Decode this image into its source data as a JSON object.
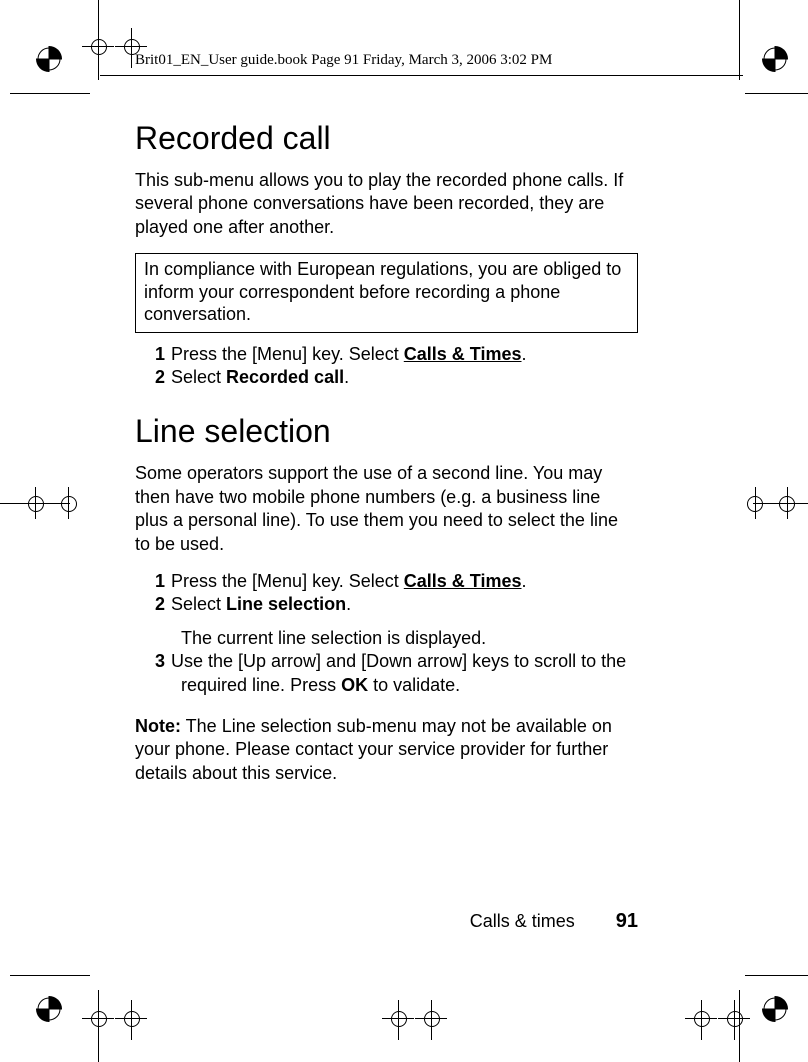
{
  "header": {
    "running_head": "Brit01_EN_User guide.book  Page 91  Friday, March 3, 2006  3:02 PM"
  },
  "section1": {
    "heading": "Recorded call",
    "intro": "This sub-menu allows you to play the recorded phone calls. If several phone conversations have been recorded, they are played one after another.",
    "notice": "In compliance with European regulations, you are obliged to inform your correspondent before recording a phone conversation.",
    "steps": {
      "s1_num": "1",
      "s1_pre": "Press the [Menu] key. Select ",
      "s1_menu": "Calls & Times",
      "s1_post": ".",
      "s2_num": "2",
      "s2_pre": "Select ",
      "s2_menu": "Recorded call",
      "s2_post": "."
    }
  },
  "section2": {
    "heading": "Line selection",
    "intro": "Some operators support the use of a second line. You may then have two mobile phone numbers (e.g. a business line plus a personal line). To use them you need to select the line to be used.",
    "steps": {
      "s1_num": "1",
      "s1_pre": "Press the [Menu] key. Select ",
      "s1_menu": "Calls & Times",
      "s1_post": ".",
      "s2_num": "2",
      "s2_pre": "Select ",
      "s2_menu": "Line selection",
      "s2_post": ".",
      "s2_extra": "The current line selection is displayed.",
      "s3_num": "3",
      "s3_pre": "Use the [Up arrow] and [Down arrow] keys to scroll to the required line. Press ",
      "s3_menu": "OK",
      "s3_post": " to validate."
    },
    "note_label": "Note:",
    "note_text": " The Line selection sub-menu may not be available on your phone. Please contact your service provider for further details about this service."
  },
  "footer": {
    "chapter": "Calls & times",
    "page": "91"
  }
}
